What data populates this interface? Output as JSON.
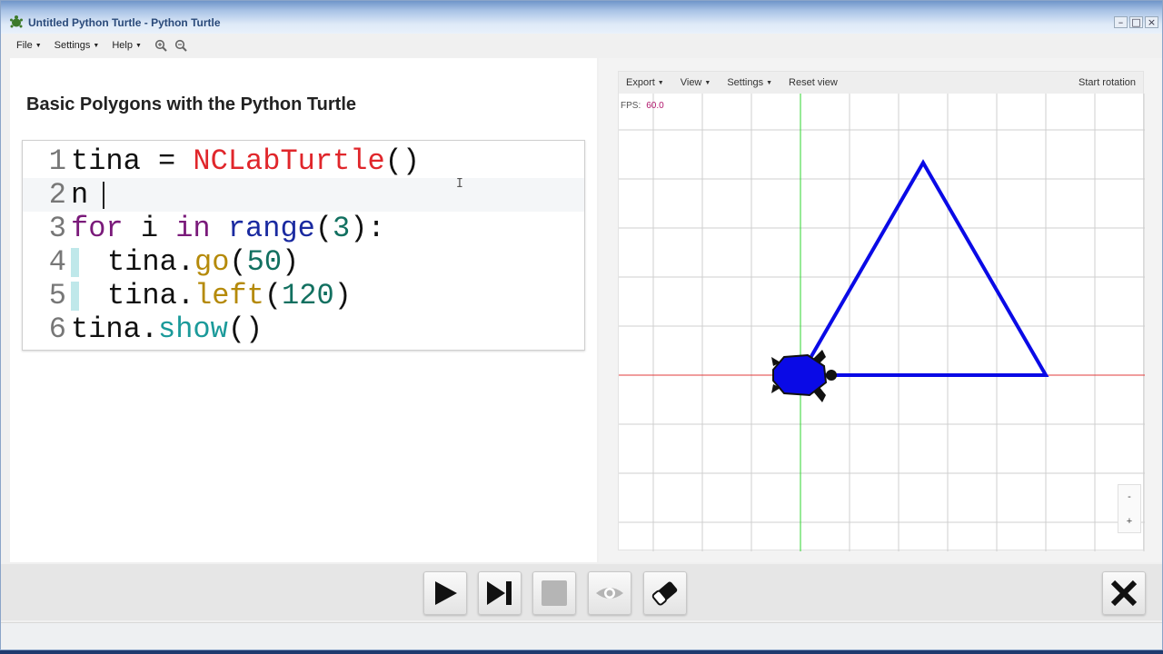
{
  "window": {
    "title": "Untitled Python Turtle - Python Turtle"
  },
  "menu": {
    "items": [
      "File",
      "Settings",
      "Help"
    ]
  },
  "heading": "Basic Polygons with the Python Turtle",
  "editor": {
    "lines": [
      {
        "num": "1",
        "tokens": [
          [
            "tina = ",
            ""
          ],
          [
            "NCLabTurtle",
            "fn"
          ],
          [
            "()",
            ""
          ]
        ]
      },
      {
        "num": "2",
        "tokens": [
          [
            "n",
            ""
          ]
        ]
      },
      {
        "num": "3",
        "tokens": [
          [
            "for",
            "kw"
          ],
          [
            " i ",
            ""
          ],
          [
            "in",
            "kw"
          ],
          [
            " ",
            ""
          ],
          [
            "range",
            "bi"
          ],
          [
            "(",
            ""
          ],
          [
            "3",
            "num"
          ],
          [
            "):",
            ""
          ]
        ]
      },
      {
        "num": "4",
        "tokens": [
          [
            "tina.",
            ""
          ],
          [
            "go",
            "meth"
          ],
          [
            "(",
            ""
          ],
          [
            "50",
            "num"
          ],
          [
            ")",
            ""
          ]
        ]
      },
      {
        "num": "5",
        "tokens": [
          [
            "tina.",
            ""
          ],
          [
            "left",
            "meth"
          ],
          [
            "(",
            ""
          ],
          [
            "120",
            "num"
          ],
          [
            ")",
            ""
          ]
        ]
      },
      {
        "num": "6",
        "tokens": [
          [
            "tina.",
            ""
          ],
          [
            "show",
            "meth2"
          ],
          [
            "()",
            ""
          ]
        ]
      }
    ]
  },
  "canvas_toolbar": {
    "export": "Export",
    "view": "View",
    "settings": "Settings",
    "reset": "Reset view",
    "rotation": "Start rotation"
  },
  "fps": {
    "label": "FPS:",
    "value": "60.0"
  },
  "zoom": {
    "minus": "-",
    "plus": "+"
  },
  "colors": {
    "pen": "#0a0ae6",
    "turtle": "#0a0ae6",
    "x_axis": "#e23b3b",
    "y_axis": "#2fd62f",
    "grid": "#cfcfcf"
  },
  "icons": [
    "turtle-app-icon",
    "zoom-in-icon",
    "zoom-out-icon",
    "play-icon",
    "step-icon",
    "stop-icon",
    "eye-icon",
    "eraser-icon",
    "close-icon"
  ]
}
